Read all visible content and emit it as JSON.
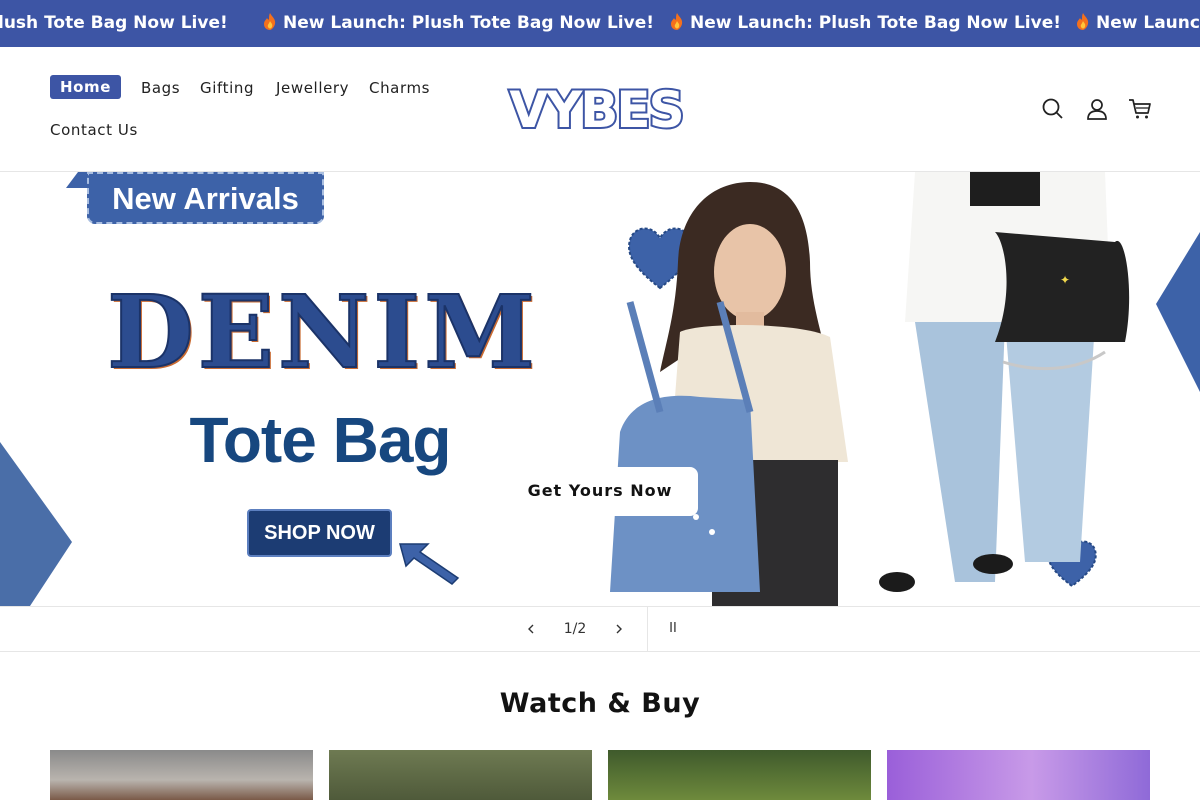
{
  "announcement": {
    "items": [
      "lush Tote Bag Now Live!",
      "New Launch: Plush Tote Bag Now Live!",
      "New Launch: Plush Tote Bag Now Live!",
      "New Launch"
    ],
    "icon": "fire-icon"
  },
  "header": {
    "nav": [
      {
        "label": "Home",
        "active": true
      },
      {
        "label": "Bags"
      },
      {
        "label": "Gifting"
      },
      {
        "label": "Jewellery"
      },
      {
        "label": "Charms"
      },
      {
        "label": "Contact Us"
      }
    ],
    "logo": "VYBES",
    "icons": [
      "search-icon",
      "account-icon",
      "cart-icon"
    ]
  },
  "hero": {
    "badge": "New Arrivals",
    "headline": "DENIM",
    "subheadline": "Tote Bag",
    "shop_button": "SHOP NOW",
    "cta": "Get Yours Now"
  },
  "slider": {
    "counter": "1/2",
    "prev": "‹",
    "next": "›",
    "pause": "II"
  },
  "section": {
    "title": "Watch & Buy"
  },
  "colors": {
    "brand": "#3d55a5",
    "denim_dark": "#1c3c73",
    "denim_mid": "#3d62a8"
  }
}
